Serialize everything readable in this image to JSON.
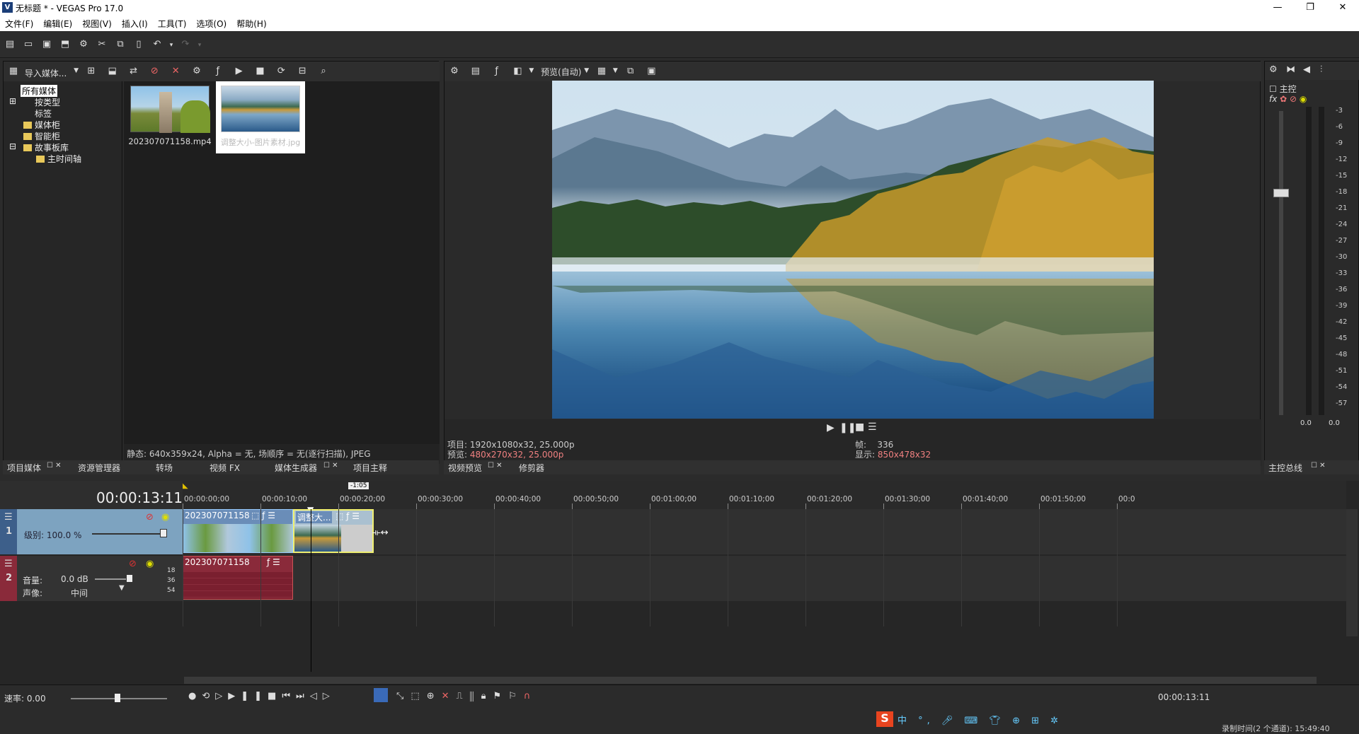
{
  "window": {
    "title": "无标题 * - VEGAS Pro 17.0",
    "app_icon": "V"
  },
  "menu": [
    "文件(F)",
    "编辑(E)",
    "视图(V)",
    "插入(I)",
    "工具(T)",
    "选项(O)",
    "帮助(H)"
  ],
  "media_panel": {
    "import_label": "导入媒体...",
    "tree": [
      {
        "label": "所有媒体",
        "selected": true
      },
      {
        "label": "按类型"
      },
      {
        "label": "标签"
      },
      {
        "label": "媒体柜"
      },
      {
        "label": "智能柜"
      },
      {
        "label": "故事板库"
      },
      {
        "label": "主时间轴"
      }
    ],
    "items": [
      {
        "name": "202307071158.mp4"
      },
      {
        "name": "调整大小-图片素材.jpg"
      }
    ],
    "status": "静态: 640x359x24, Alpha = 无, 场顺序 = 无(逐行扫描), JPEG",
    "tabs": [
      "项目媒体",
      "资源管理器",
      "转场",
      "视频 FX",
      "媒体生成器",
      "项目主释"
    ]
  },
  "preview": {
    "mode_label": "预览(自动)",
    "project": "项目: 1920x1080x32, 25.000p",
    "preview_label": "预览:",
    "preview_value": "480x270x32, 25.000p",
    "frame_label": "帧:",
    "frame_value": "336",
    "display_label": "显示:",
    "display_value": "850x478x32",
    "tabs": [
      "视频预览",
      "修剪器"
    ]
  },
  "mixer": {
    "title": "主控",
    "scale": [
      "3",
      "6",
      "9",
      "12",
      "15",
      "18",
      "21",
      "24",
      "27",
      "30",
      "33",
      "36",
      "39",
      "42",
      "45",
      "48",
      "51",
      "54",
      "57"
    ],
    "left_value": "0.0",
    "right_value": "0.0",
    "tab": "主控总线"
  },
  "timeline": {
    "timecode": "00:00:13:11",
    "loop_length": "-1:05",
    "ruler": [
      "00:00:00;00",
      "00:00:10;00",
      "00:00:20;00",
      "00:00:30;00",
      "00:00:40;00",
      "00:00:50;00",
      "00:01:00;00",
      "00:01:10;00",
      "00:01:20;00",
      "00:01:30;00",
      "00:01:40;00",
      "00:01:50;00",
      "00:0"
    ],
    "video_track": {
      "number": "1",
      "level_label": "级别: 100.0 %",
      "clip1": "202307071158",
      "clip2": "调整大..."
    },
    "audio_track": {
      "number": "2",
      "volume_label": "音量:",
      "volume_value": "0.0 dB",
      "pan_label": "声像:",
      "pan_value": "中间",
      "clip": "202307071158",
      "meter": [
        "18",
        "36",
        "54"
      ]
    },
    "rate_label": "速率: 0.00",
    "end_timecode": "00:00:13:11",
    "record_time": "录制时间(2 个通道): 15:49:40"
  },
  "colors": {
    "video_track": "#7da3c0",
    "audio_track": "#8a2a3a",
    "clip_selected": "#f0f070"
  }
}
